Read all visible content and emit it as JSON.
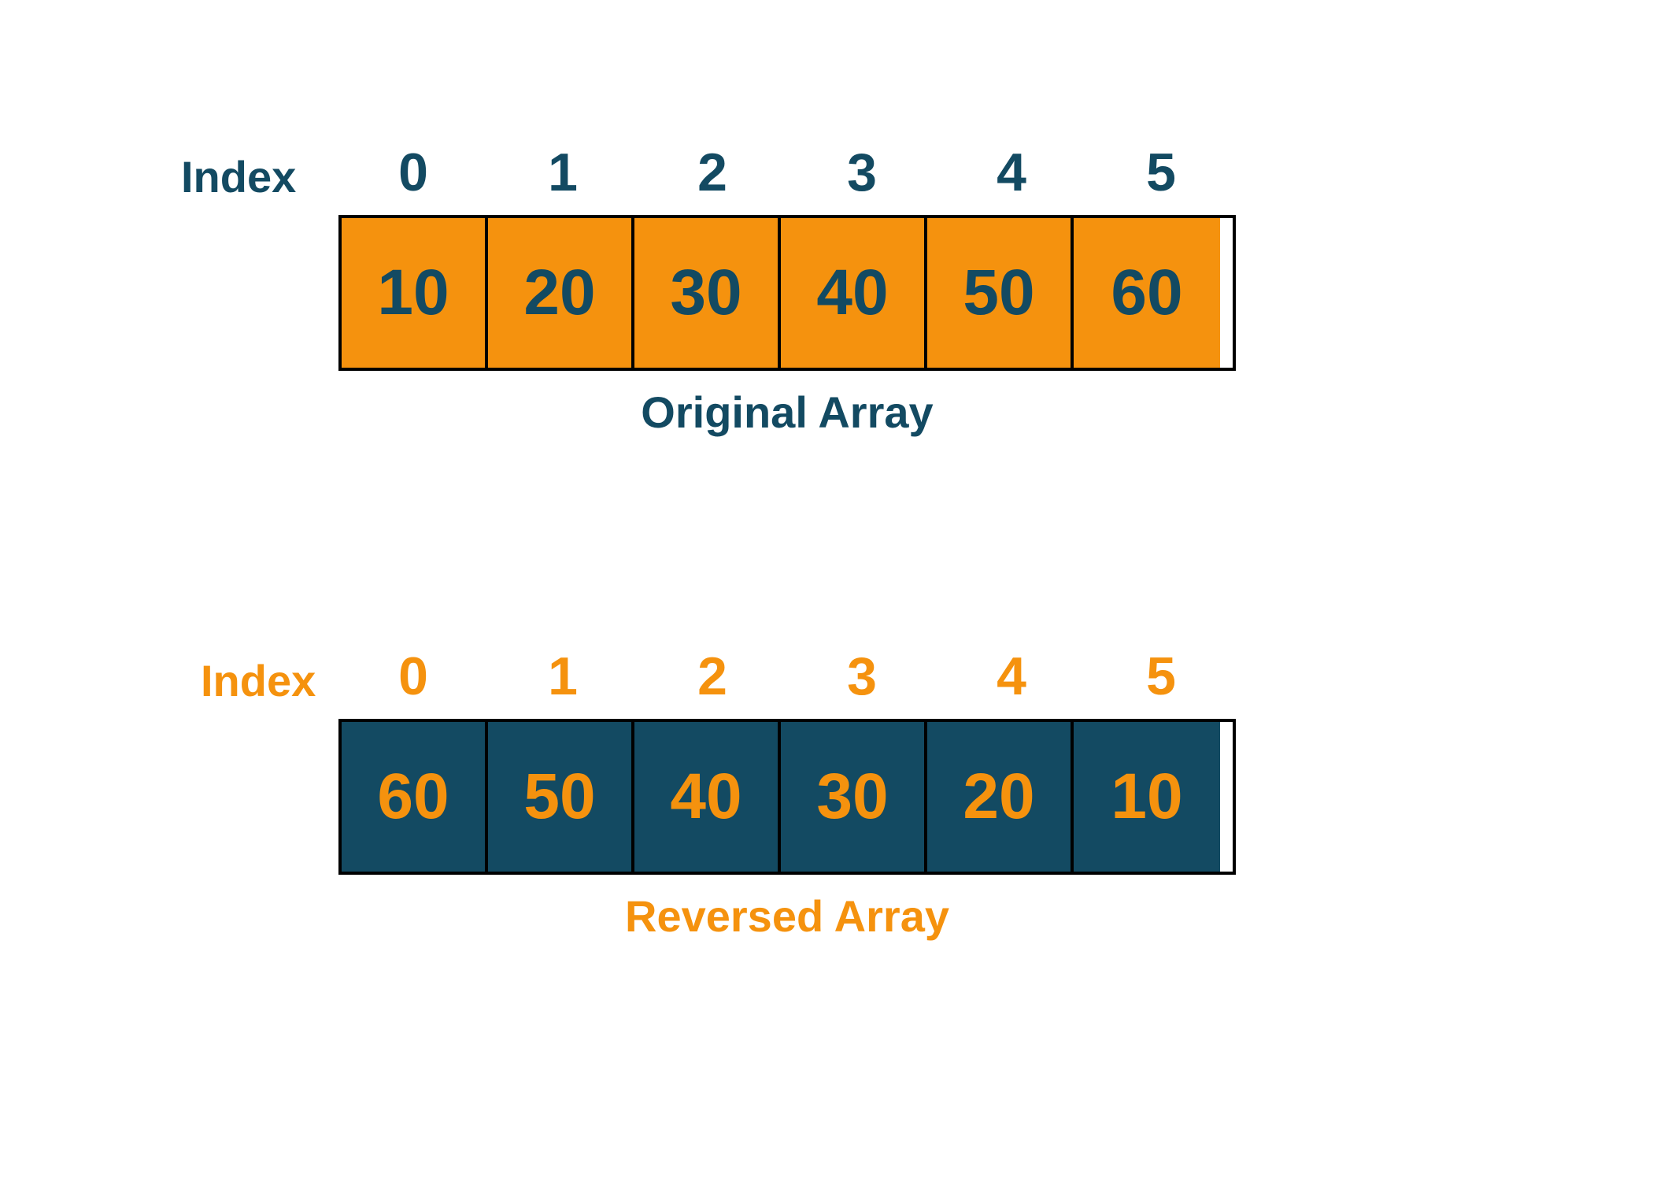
{
  "original": {
    "indexLabel": "Index",
    "indices": [
      "0",
      "1",
      "2",
      "3",
      "4",
      "5"
    ],
    "values": [
      "10",
      "20",
      "30",
      "40",
      "50",
      "60"
    ],
    "caption": "Original Array"
  },
  "reversed": {
    "indexLabel": "Index",
    "indices": [
      "0",
      "1",
      "2",
      "3",
      "4",
      "5"
    ],
    "values": [
      "60",
      "50",
      "40",
      "30",
      "20",
      "10"
    ],
    "caption": "Reversed Array"
  },
  "colors": {
    "darkBlue": "#134a62",
    "orange": "#f5920e"
  }
}
